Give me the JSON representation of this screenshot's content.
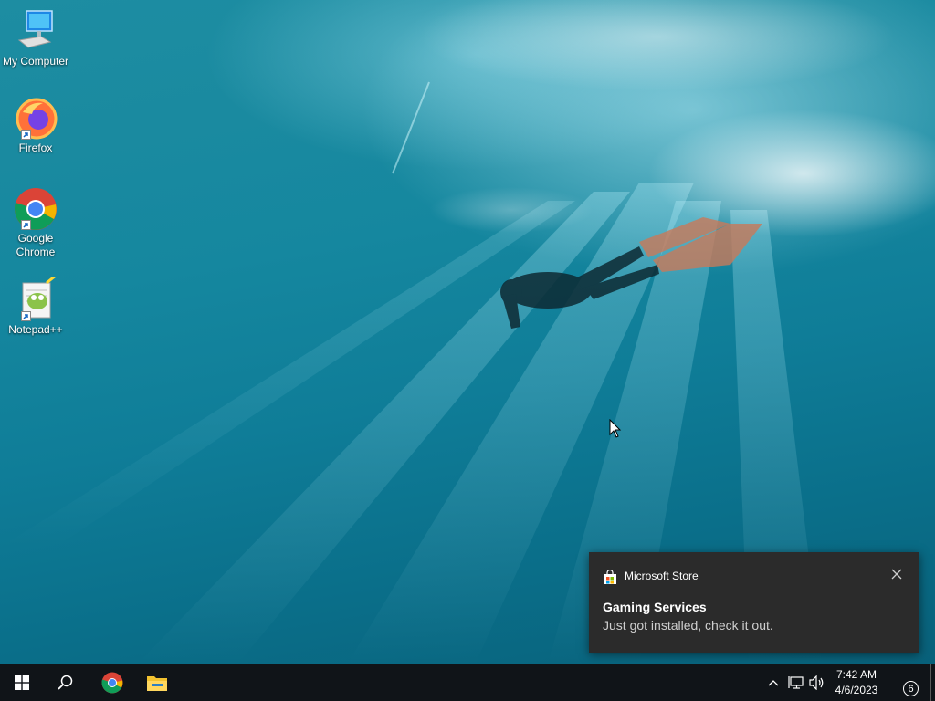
{
  "desktop": {
    "icons": [
      {
        "label": "My Computer",
        "icon": "computer-icon"
      },
      {
        "label": "Firefox",
        "icon": "firefox-icon"
      },
      {
        "label": "Google Chrome",
        "icon": "chrome-icon"
      },
      {
        "label": "Notepad++",
        "icon": "notepadpp-icon"
      }
    ]
  },
  "toast": {
    "app_name": "Microsoft Store",
    "title": "Gaming Services",
    "body": "Just got installed, check it out.",
    "app_icon": "store-bag-icon",
    "close_icon": "close-icon"
  },
  "taskbar": {
    "start_icon": "windows-logo-icon",
    "search_icon": "search-icon",
    "pinned": [
      "chrome-icon",
      "file-explorer-icon"
    ],
    "tray_icons": [
      "chevron-up-icon",
      "network-icon",
      "volume-icon"
    ],
    "time": "7:42 AM",
    "date": "4/6/2023",
    "notification_count": "6"
  },
  "colors": {
    "taskbar_bg": "#101418",
    "toast_bg": "#2b2b2b",
    "water_mid": "#15879f"
  }
}
